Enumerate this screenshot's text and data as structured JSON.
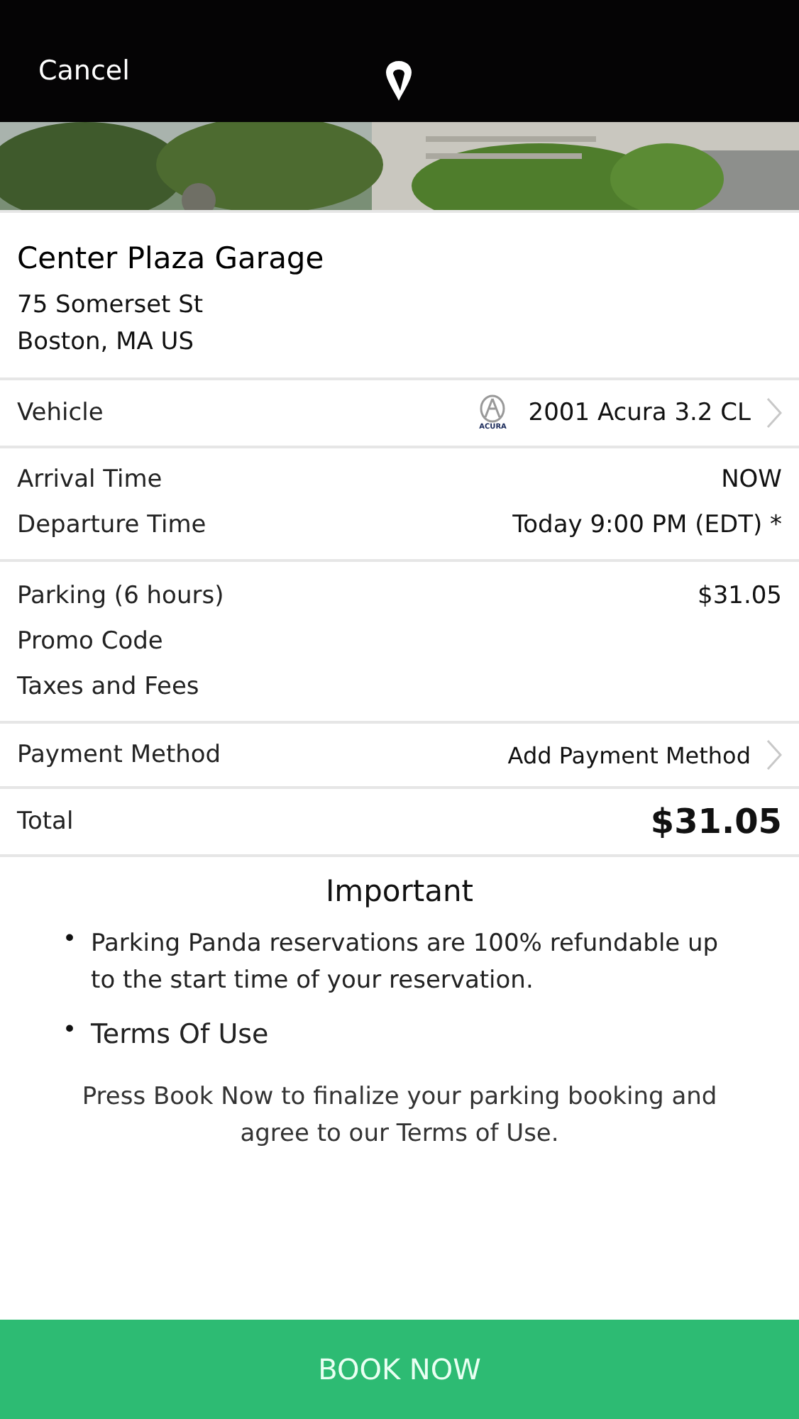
{
  "top_bar": {
    "cancel": "Cancel"
  },
  "garage": {
    "name": "Center Plaza Garage",
    "address_lines": [
      "75 Somerset St",
      "Boston, MA US"
    ]
  },
  "vehicle": {
    "label": "Vehicle",
    "brand_mark": "ACURA",
    "value": "2001 Acura 3.2 CL"
  },
  "times": [
    {
      "label": "Arrival Time",
      "value": "NOW"
    },
    {
      "label": "Departure Time",
      "value": "Today 9:00 PM (EDT) *"
    }
  ],
  "fees": [
    {
      "label": "Parking (6 hours)",
      "value": "$31.05"
    },
    {
      "label": "Promo Code"
    },
    {
      "label": "Taxes and Fees"
    }
  ],
  "payment": {
    "label": "Payment Method",
    "value": "Add Payment Method"
  },
  "total": {
    "label": "Total",
    "value": "$31.05"
  },
  "important": {
    "title": "Important",
    "bullets": [
      {
        "bullet": "•",
        "text": "Parking Panda reservations are 100% refundable up to the start time of your reservation.",
        "kind": "note"
      },
      {
        "bullet": "•",
        "text": "Terms Of Use",
        "kind": "heading"
      }
    ],
    "footer": "Press Book Now to finalize your parking booking and agree to our Terms of Use."
  },
  "book_button": "BOOK NOW"
}
